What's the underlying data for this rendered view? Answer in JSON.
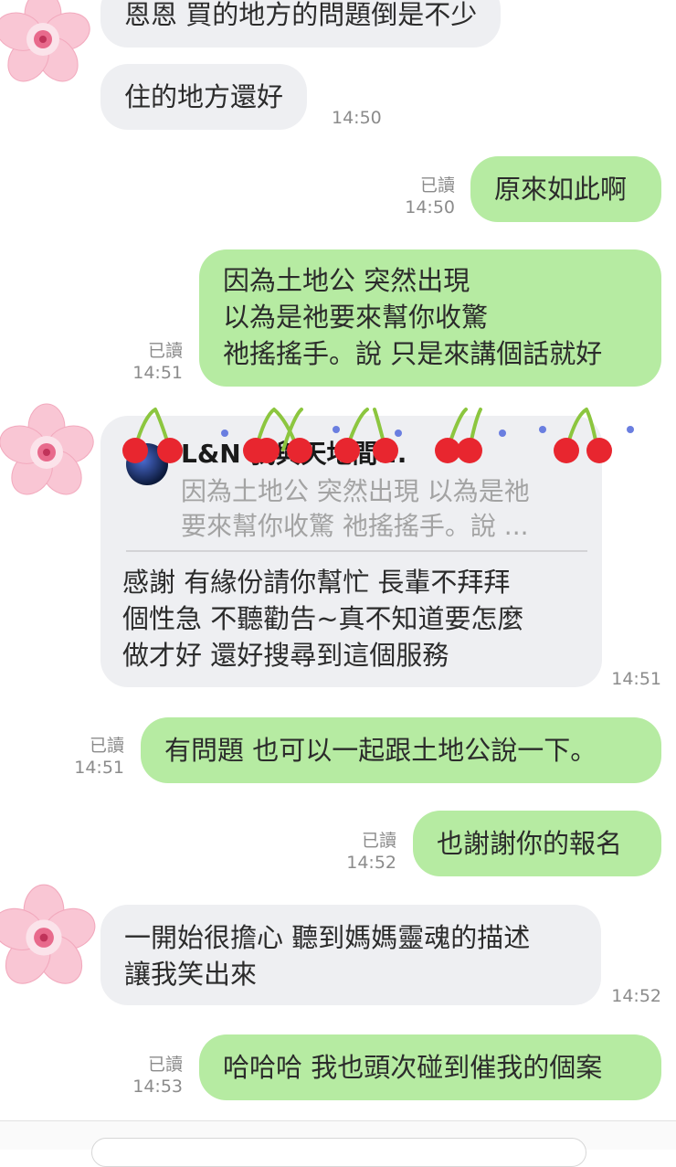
{
  "messages": [
    {
      "lines": [
        "恩恩 買的地方的問題倒是不少"
      ]
    },
    {
      "lines": [
        "住的地方還好"
      ],
      "time": "14:50"
    },
    {
      "lines": [
        "原來如此啊"
      ],
      "read": "已讀",
      "time": "14:50"
    },
    {
      "lines": [
        "因為土地公 突然出現",
        "以為是祂要來幫你收驚",
        "祂搖搖手。說 只是來講個話就好"
      ],
      "read": "已讀",
      "time": "14:51"
    },
    {
      "lines": [
        "感謝 有緣份請你幫忙 長輩不拜拜",
        "個性急 不聽勸告~真不知道要怎麼",
        "做才好 還好搜尋到這個服務"
      ],
      "time": "14:51",
      "reply": {
        "name": "L&N 我與天地間...",
        "quote": [
          "因為土地公 突然出現 以為是祂",
          "要來幫你收驚 祂搖搖手。說 ..."
        ]
      }
    },
    {
      "lines": [
        "有問題 也可以一起跟土地公說一下。"
      ],
      "read": "已讀",
      "time": "14:51"
    },
    {
      "lines": [
        "也謝謝你的報名"
      ],
      "read": "已讀",
      "time": "14:52"
    },
    {
      "lines": [
        "一開始很擔心 聽到媽媽靈魂的描述",
        "讓我笑出來"
      ],
      "time": "14:52"
    },
    {
      "lines": [
        "哈哈哈 我也頭次碰到催我的個案"
      ],
      "read": "已讀",
      "time": "14:53"
    }
  ],
  "colors": {
    "incoming": "#eeeff2",
    "outgoing": "#b6eba2",
    "meta": "#8b8b8b"
  },
  "icons": [
    "sakura-avatar-icon",
    "cherry-decoration-icon"
  ]
}
